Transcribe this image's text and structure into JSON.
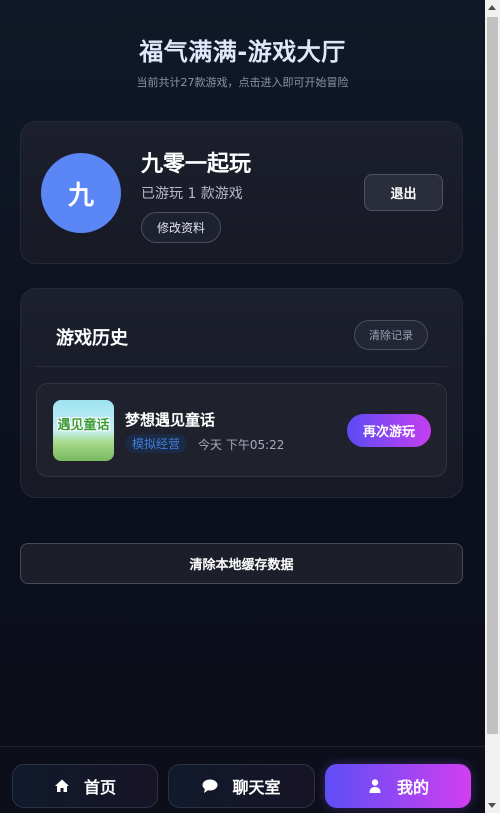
{
  "header": {
    "title": "福气满满-游戏大厅",
    "subtitle": "当前共计27款游戏，点击进入即可开始冒险"
  },
  "profile": {
    "avatar_char": "九",
    "username": "九零一起玩",
    "played_text": "已游玩 1 款游戏",
    "edit_label": "修改资料",
    "logout_label": "退出",
    "avatar_color": "#5b86f5"
  },
  "history": {
    "title": "游戏历史",
    "clear_label": "清除记录",
    "items": [
      {
        "thumbnail_text": "遇见童话",
        "name": "梦想遇见童话",
        "tag": "模拟经营",
        "time": "今天 下午05:22",
        "replay_label": "再次游玩"
      }
    ]
  },
  "clear_cache_label": "清除本地缓存数据",
  "bottom_nav": {
    "home_label": "首页",
    "home_icon": "home-icon",
    "chat_label": "聊天室",
    "chat_icon": "chat-bubble-icon",
    "mine_label": "我的",
    "mine_icon": "user-icon",
    "active": "我的"
  },
  "colors": {
    "accent_gradient_start": "#5b4cf5",
    "accent_gradient_end": "#c53ef0",
    "background": "#0d1220"
  }
}
